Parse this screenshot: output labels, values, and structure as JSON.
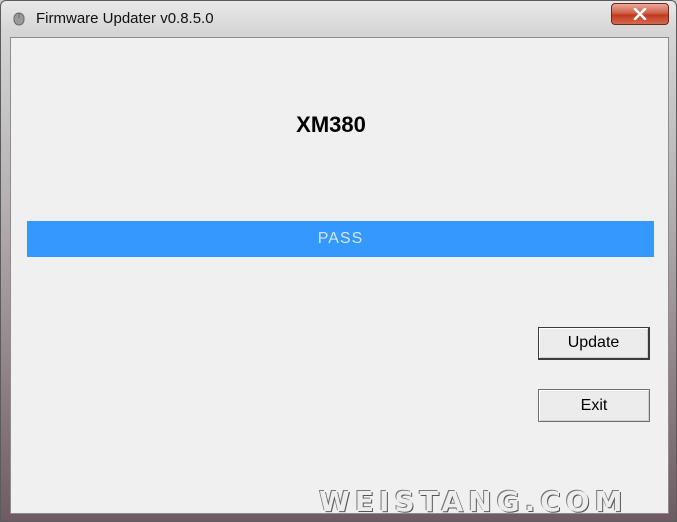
{
  "window": {
    "title": "Firmware Updater v0.8.5.0"
  },
  "titlebar": {
    "close_icon": "close-icon",
    "app_icon": "mouse-icon"
  },
  "main": {
    "model_name": "XM380",
    "progress": {
      "status_text": "PASS",
      "percent": 100,
      "color": "#3399ff"
    },
    "buttons": {
      "update_label": "Update",
      "exit_label": "Exit"
    }
  },
  "watermark": {
    "text": "WEISTANG.COM"
  }
}
